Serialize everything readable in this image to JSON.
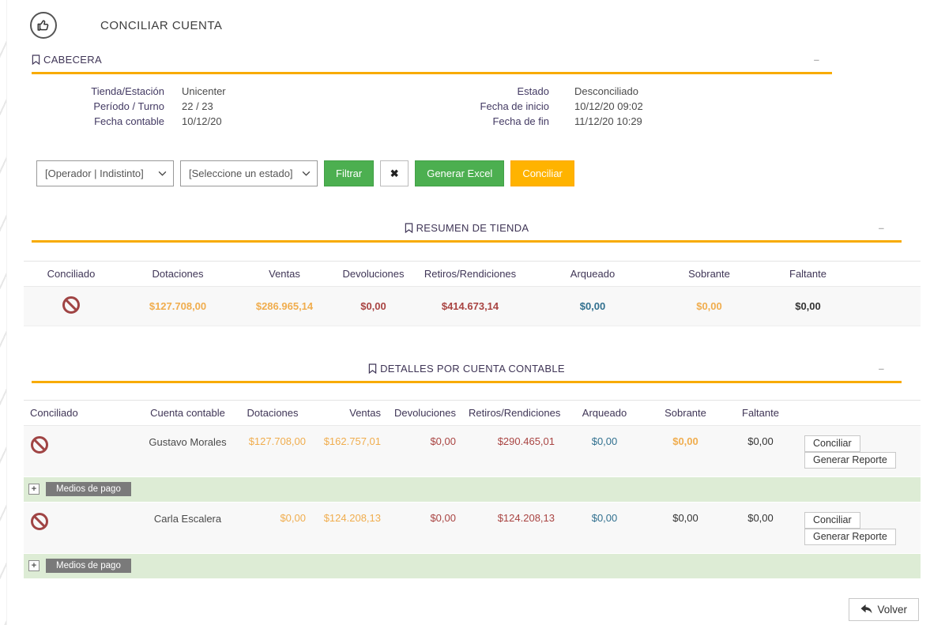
{
  "page": {
    "title": "CONCILIAR CUENTA"
  },
  "ui": {
    "collapse_glyph": "–",
    "expand_glyph": "+"
  },
  "colors": {
    "section_underline": "#F8AB00",
    "button_green": "#4CAF50",
    "button_amber": "#FFB300",
    "label_purple": "#433A63",
    "money_orange": "#F0AD4E",
    "money_red": "#A94442",
    "money_blue": "#31708F",
    "medios_row_green": "#DDECD5"
  },
  "cabecera": {
    "title": "CABECERA",
    "left_fields": [
      {
        "label": "Tienda/Estación",
        "value": "Unicenter"
      },
      {
        "label": "Período / Turno",
        "value": "22 / 23"
      },
      {
        "label": "Fecha contable",
        "value": "10/12/20"
      }
    ],
    "right_fields": [
      {
        "label": "Estado",
        "value": "Desconciliado"
      },
      {
        "label": "Fecha de inicio",
        "value": "10/12/20 09:02"
      },
      {
        "label": "Fecha de fin",
        "value": "11/12/20 10:29"
      }
    ]
  },
  "filters": {
    "operator_select": "[Operador | Indistinto]",
    "state_select": "[Seleccione un estado]",
    "filter_button": "Filtrar",
    "clear_button": "✖",
    "excel_button": "Generar Excel",
    "conciliar_button": "Conciliar"
  },
  "resumen": {
    "title": "RESUMEN DE TIENDA",
    "columns": [
      "Conciliado",
      "Dotaciones",
      "Ventas",
      "Devoluciones",
      "Retiros/Rendiciones",
      "Arqueado",
      "Sobrante",
      "Faltante"
    ],
    "row": {
      "conciliado_icon": "no-entry-icon",
      "dotaciones": "$127.708,00",
      "ventas": "$286.965,14",
      "devoluciones": "$0,00",
      "retiros": "$414.673,14",
      "arqueado": "$0,00",
      "sobrante": "$0,00",
      "faltante": "$0,00"
    }
  },
  "detalles": {
    "title": "DETALLES POR CUENTA CONTABLE",
    "columns": [
      "Conciliado",
      "Cuenta contable",
      "Dotaciones",
      "Ventas",
      "Devoluciones",
      "Retiros/Rendiciones",
      "Arqueado",
      "Sobrante",
      "Faltante"
    ],
    "conciliar_button": "Conciliar",
    "reporte_button": "Generar Reporte",
    "medios_label": "Medios de pago",
    "rows": [
      {
        "cuenta": "Gustavo Morales",
        "dotaciones": "$127.708,00",
        "ventas": "$162.757,01",
        "devoluciones": "$0,00",
        "retiros": "$290.465,01",
        "arqueado": "$0,00",
        "sobrante": "$0,00",
        "faltante": "$0,00"
      },
      {
        "cuenta": "Carla Escalera",
        "dotaciones": "$0,00",
        "ventas": "$124.208,13",
        "devoluciones": "$0,00",
        "retiros": "$124.208,13",
        "arqueado": "$0,00",
        "sobrante": "$0,00",
        "faltante": "$0,00"
      }
    ]
  },
  "footer": {
    "volver_button": "Volver"
  }
}
